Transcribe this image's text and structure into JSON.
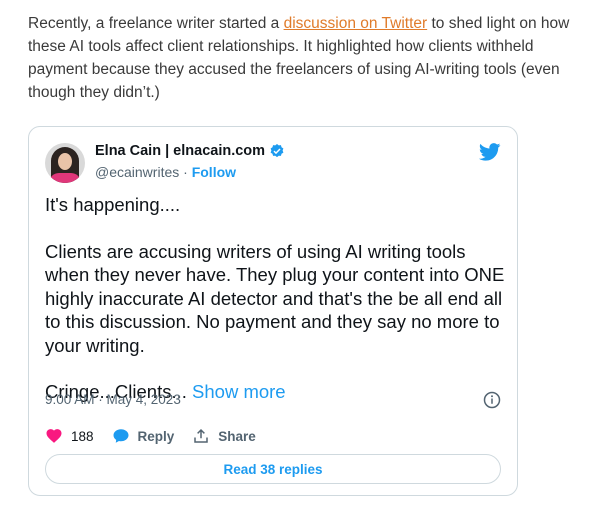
{
  "intro": {
    "text_before": "Recently, a freelance writer started a ",
    "link": "discussion on Twitter",
    "text_after": " to shed light on how these AI tools affect client relationships. It highlighted how clients withheld payment because they accused the freelancers of using AI-writing tools (even though they didn’t.)",
    "link_color": "#e07b2a"
  },
  "tweet": {
    "author_name": "Elna Cain | elnacain.com",
    "handle": "@ecainwrites",
    "separator": " · ",
    "follow_label": "Follow",
    "paragraphs": [
      "It's happening....",
      "Clients are accusing writers of using AI writing tools when they never have. They plug your content into ONE highly inaccurate AI detector and that's the be all end all to this discussion. No payment and they  say no more to your writing."
    ],
    "last_line": "Cringe...Clients... ",
    "show_more": "Show more",
    "timestamp": "9:00 AM · May 4, 2023",
    "likes": "188",
    "reply_label": "Reply",
    "share_label": "Share",
    "read_replies": "Read 38 replies",
    "icons": [
      "verified-badge-icon",
      "twitter-bird-icon",
      "info-icon",
      "heart-icon",
      "reply-bubble-icon",
      "share-icon"
    ],
    "colors": {
      "accent": "#1d9bf0",
      "heart": "#f91880",
      "muted": "#536471"
    }
  }
}
